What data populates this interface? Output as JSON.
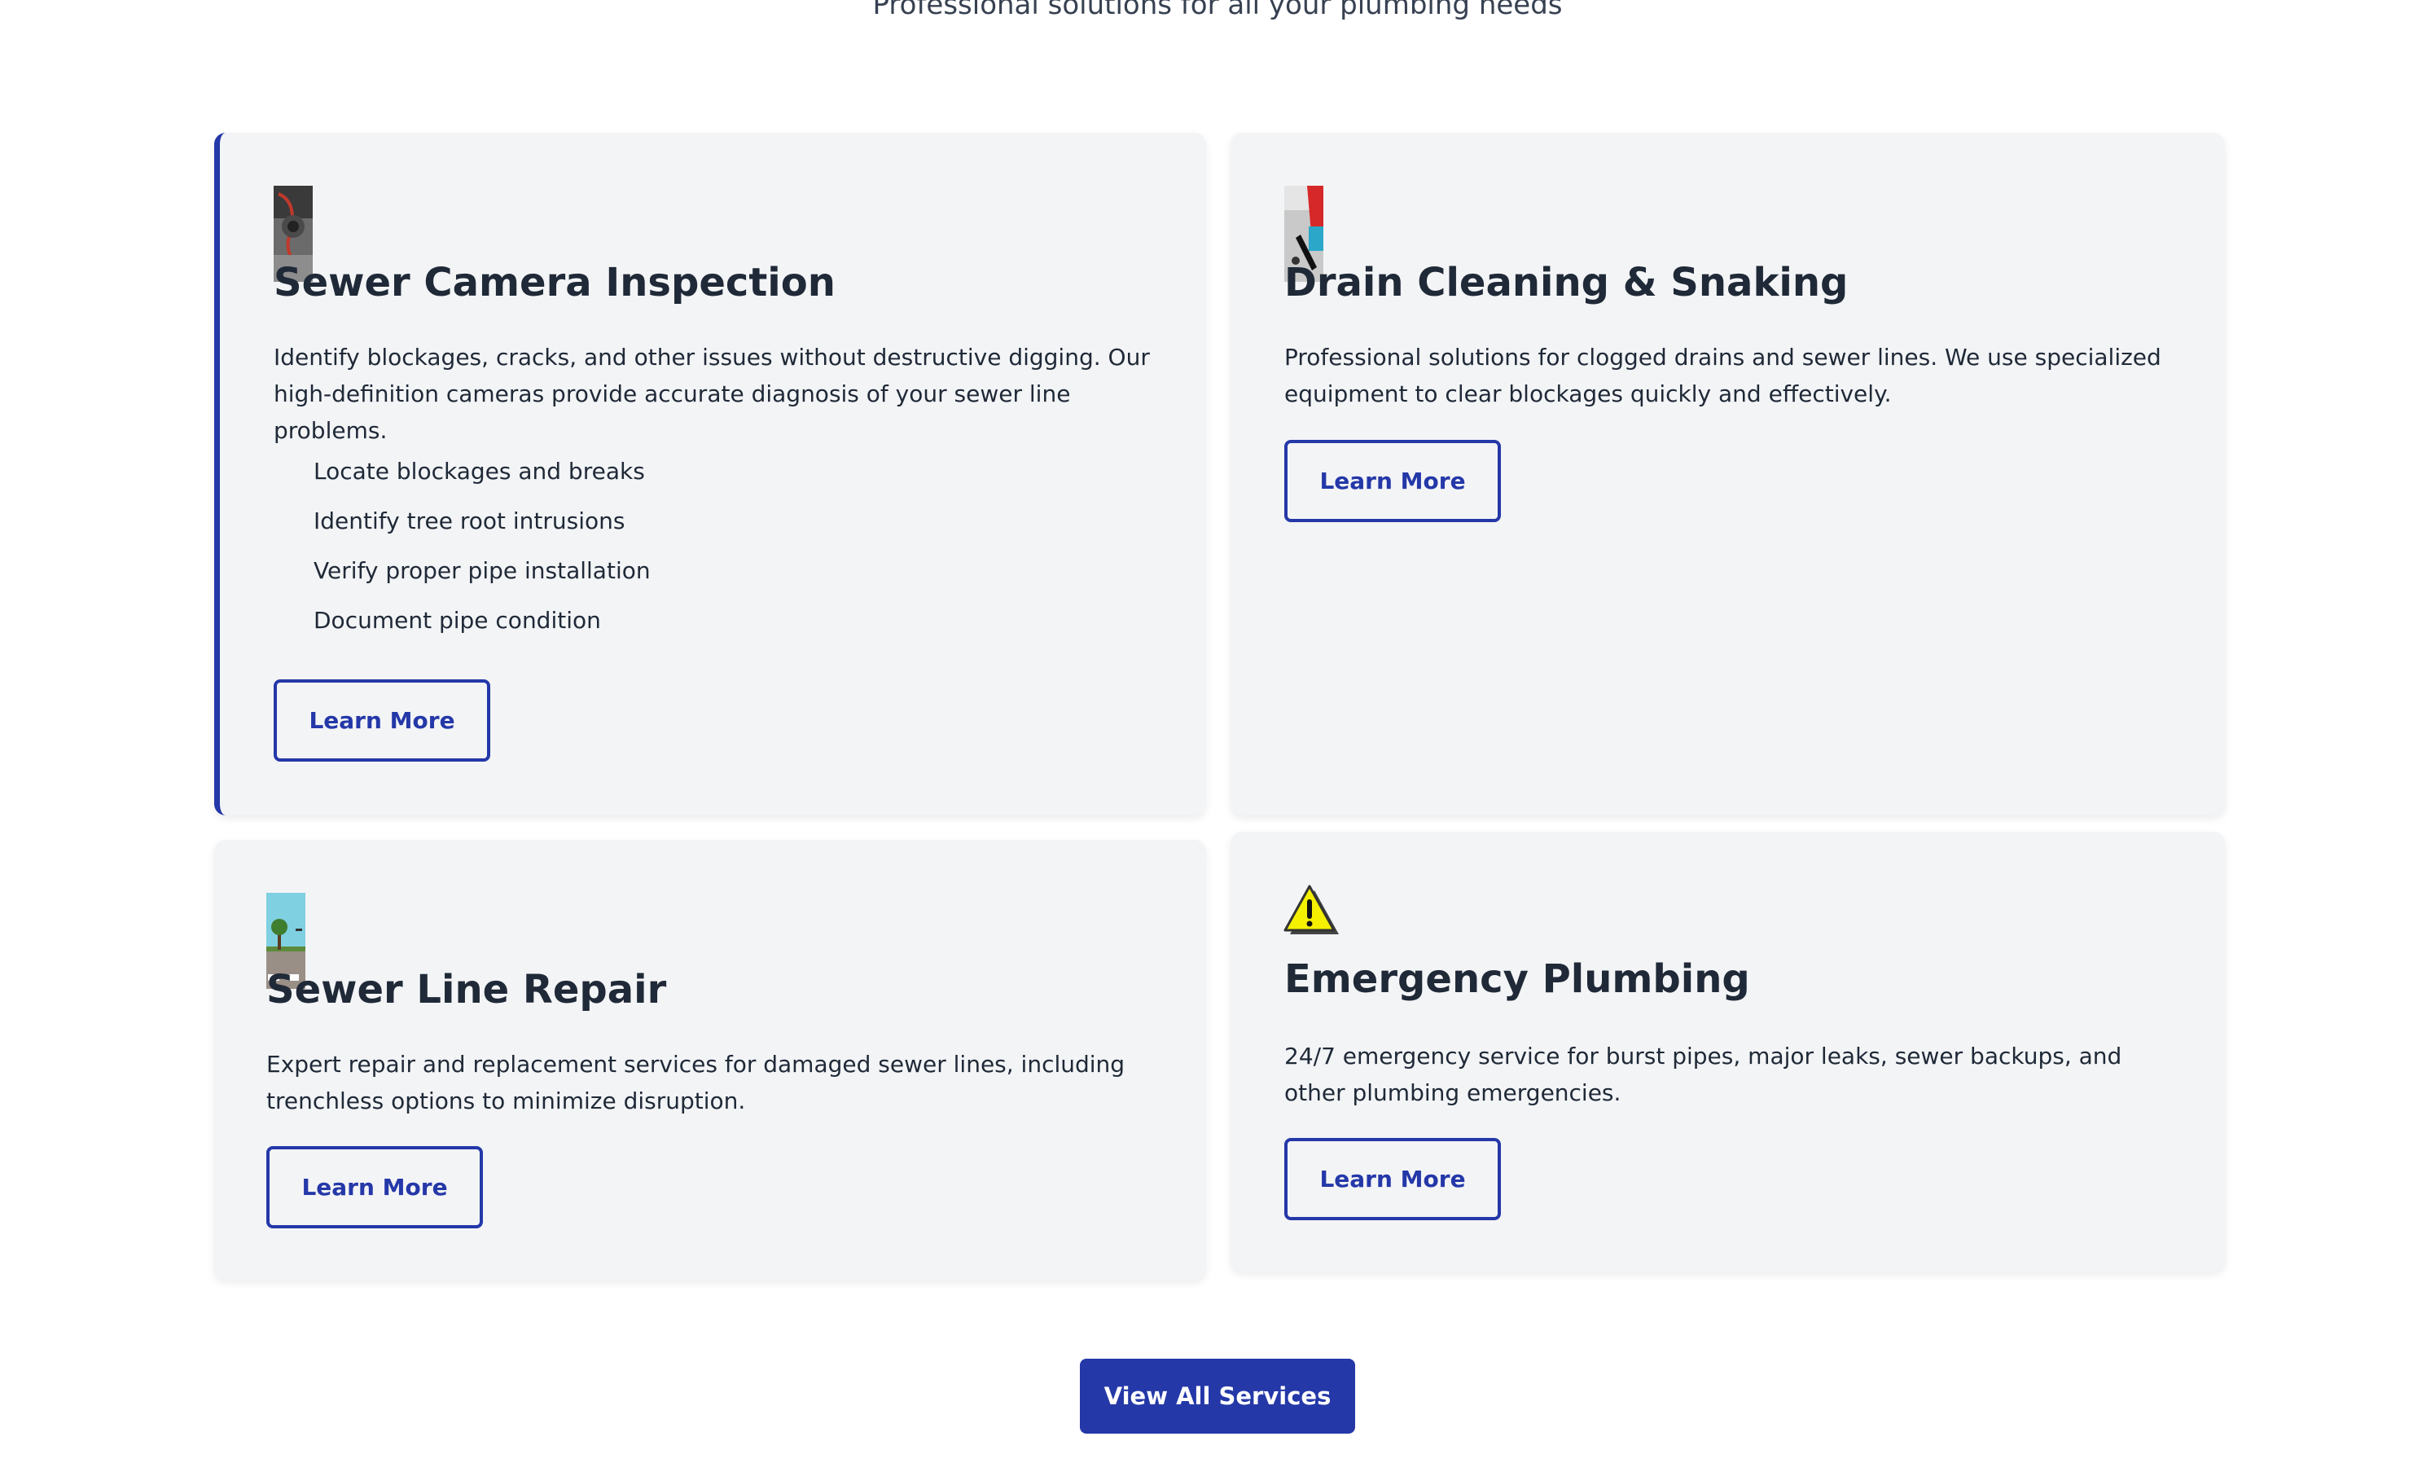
{
  "section": {
    "subtitle": "Professional solutions for all your plumbing needs"
  },
  "services": [
    {
      "icon": "sewer-camera-photo-icon",
      "title": "Sewer Camera Inspection",
      "description": "Identify blockages, cracks, and other issues without destructive digging. Our high-definition cameras provide accurate diagnosis of your sewer line problems.",
      "features": [
        "Locate blockages and breaks",
        "Identify tree root intrusions",
        "Verify proper pipe installation",
        "Document pipe condition"
      ],
      "button_label": "Learn More"
    },
    {
      "icon": "drain-cleaning-photo-icon",
      "title": "Drain Cleaning & Snaking",
      "description": "Professional solutions for clogged drains and sewer lines. We use specialized equipment to clear blockages quickly and effectively.",
      "button_label": "Learn More"
    },
    {
      "icon": "sewer-line-repair-photo-icon",
      "title": "Sewer Line Repair",
      "description": "Expert repair and replacement services for damaged sewer lines, including trenchless options to minimize disruption.",
      "button_label": "Learn More"
    },
    {
      "icon": "warning-icon",
      "title": "Emergency Plumbing",
      "description": "24/7 emergency service for burst pipes, major leaks, sewer backups, and other plumbing emergencies.",
      "button_label": "Learn More"
    }
  ],
  "view_all_label": "View All Services",
  "colors": {
    "accent": "#2438a8",
    "card_bg": "#f3f4f6",
    "text": "#1f2937"
  }
}
